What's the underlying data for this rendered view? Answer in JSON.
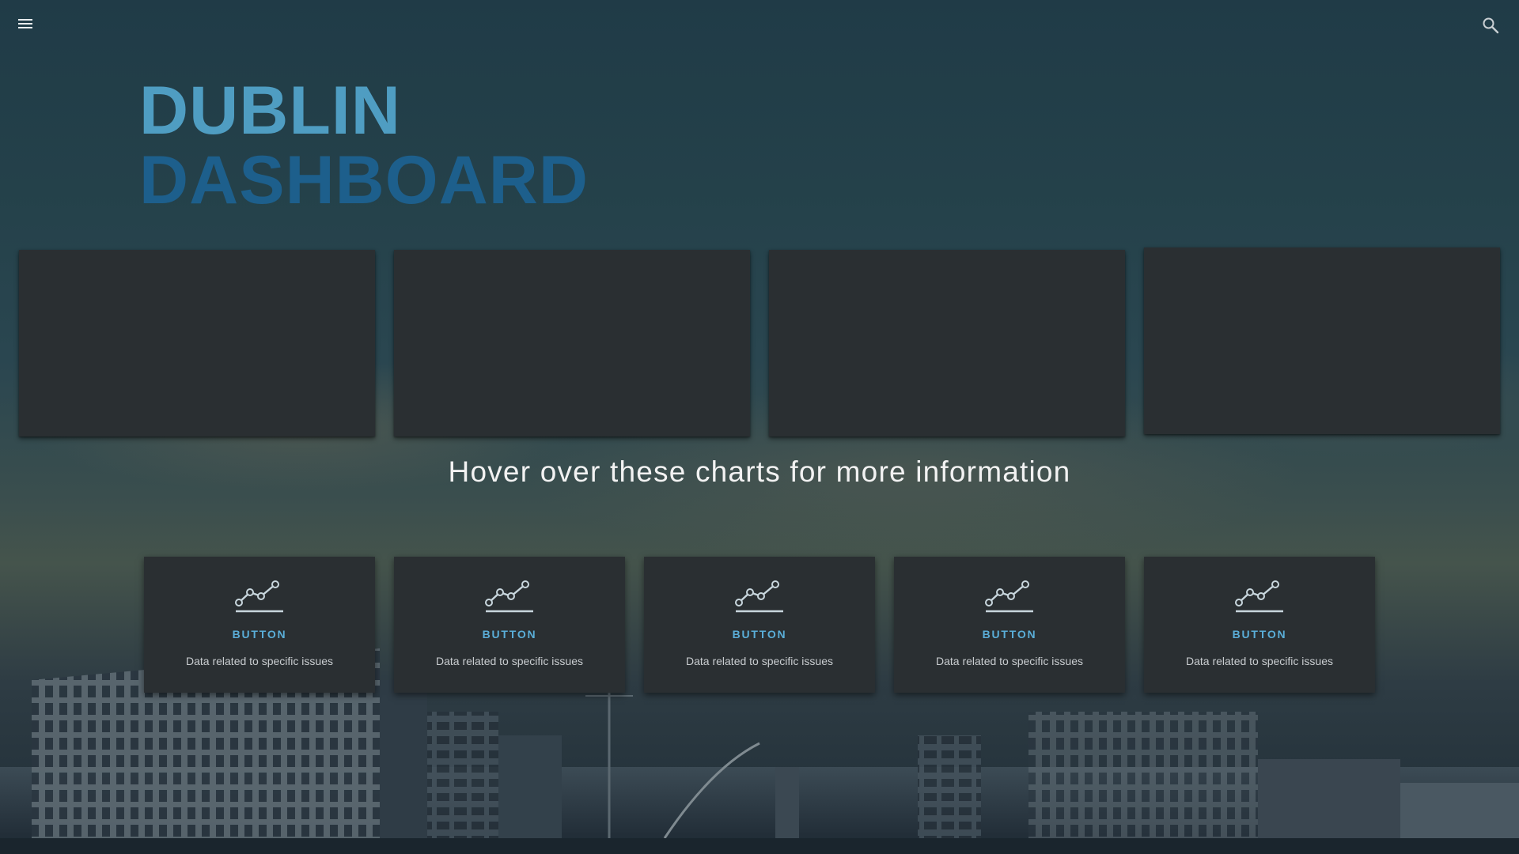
{
  "header": {
    "menu_icon": "menu-icon",
    "search_icon": "search-icon"
  },
  "title": {
    "line1": "DUBLIN",
    "line2": "DASHBOARD"
  },
  "colors": {
    "title_line1": "#4f9dc2",
    "title_line2": "#1d5f8c",
    "card_bg": "#2a2f32",
    "button_label": "#5aaed8"
  },
  "hint": "Hover over these charts for more information",
  "buttons": [
    {
      "label": "BUTTON",
      "description": "Data related to specific issues",
      "icon": "line-chart-icon"
    },
    {
      "label": "BUTTON",
      "description": "Data related to specific issues",
      "icon": "line-chart-icon"
    },
    {
      "label": "BUTTON",
      "description": "Data related to specific issues",
      "icon": "line-chart-icon"
    },
    {
      "label": "BUTTON",
      "description": "Data related to specific issues",
      "icon": "line-chart-icon"
    },
    {
      "label": "BUTTON",
      "description": "Data related to specific issues",
      "icon": "line-chart-icon"
    }
  ]
}
